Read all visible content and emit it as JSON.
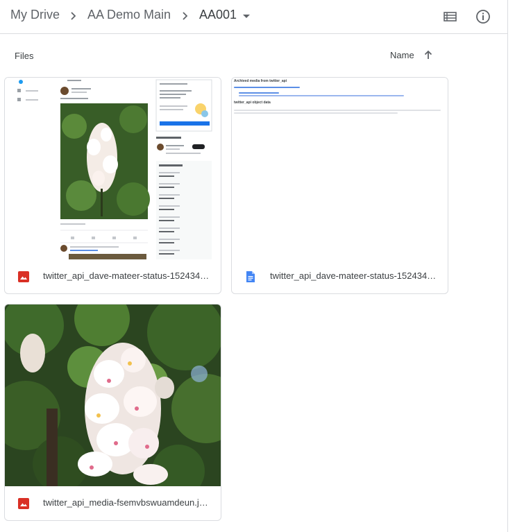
{
  "breadcrumb": {
    "items": [
      "My Drive",
      "AA Demo Main"
    ],
    "current": "AA001"
  },
  "header": {
    "list_view_icon": "list-view-icon",
    "info_icon": "info-icon"
  },
  "files_header": {
    "section_label": "Files",
    "sort_label": "Name",
    "sort_direction": "ascending"
  },
  "files": [
    {
      "name": "twitter_api_dave-mateer-status-152434…",
      "type": "image",
      "icon": "image-file-icon",
      "icon_color": "#d93025"
    },
    {
      "name": "twitter_api_dave-mateer-status-152434…",
      "type": "document",
      "icon": "doc-file-icon",
      "icon_color": "#4285f4"
    },
    {
      "name": "twitter_api_media-fsemvbswuamdeun.j…",
      "type": "image",
      "icon": "image-file-icon",
      "icon_color": "#d93025"
    }
  ],
  "doc_preview": {
    "heading": "Archived media from twitter_api",
    "subheading": "twitter_api object data"
  }
}
